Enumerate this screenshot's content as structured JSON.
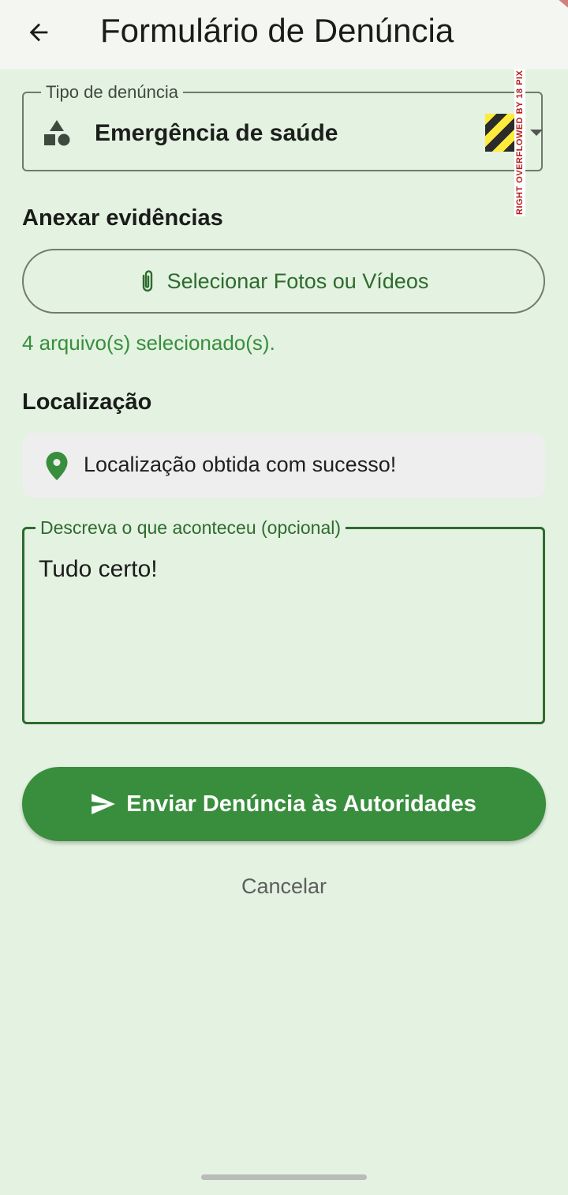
{
  "appbar": {
    "title": "Formulário de Denúncia",
    "back_icon": "arrow-left-icon"
  },
  "report_type": {
    "label": "Tipo de denúncia",
    "value": "Emergência de saúde",
    "icon": "shapes-icon",
    "overflow_warning": "RIGHT OVERFLOWED BY 18 PIX"
  },
  "evidence": {
    "section_title": "Anexar evidências",
    "button_label": "Selecionar Fotos ou Vídeos",
    "button_icon": "paperclip-icon",
    "status": "4 arquivo(s) selecionado(s)."
  },
  "location": {
    "section_title": "Localização",
    "status": "Localização obtida com sucesso!",
    "icon": "location-pin-icon",
    "icon_color": "#388e3c"
  },
  "description": {
    "label": "Descreva o que aconteceu (opcional)",
    "value": "Tudo certo!"
  },
  "actions": {
    "submit_label": "Enviar Denúncia às Autoridades",
    "submit_icon": "send-icon",
    "cancel_label": "Cancelar"
  },
  "colors": {
    "background": "#e3f2e1",
    "primary": "#388e3c",
    "primary_dark": "#2e6b2e"
  }
}
